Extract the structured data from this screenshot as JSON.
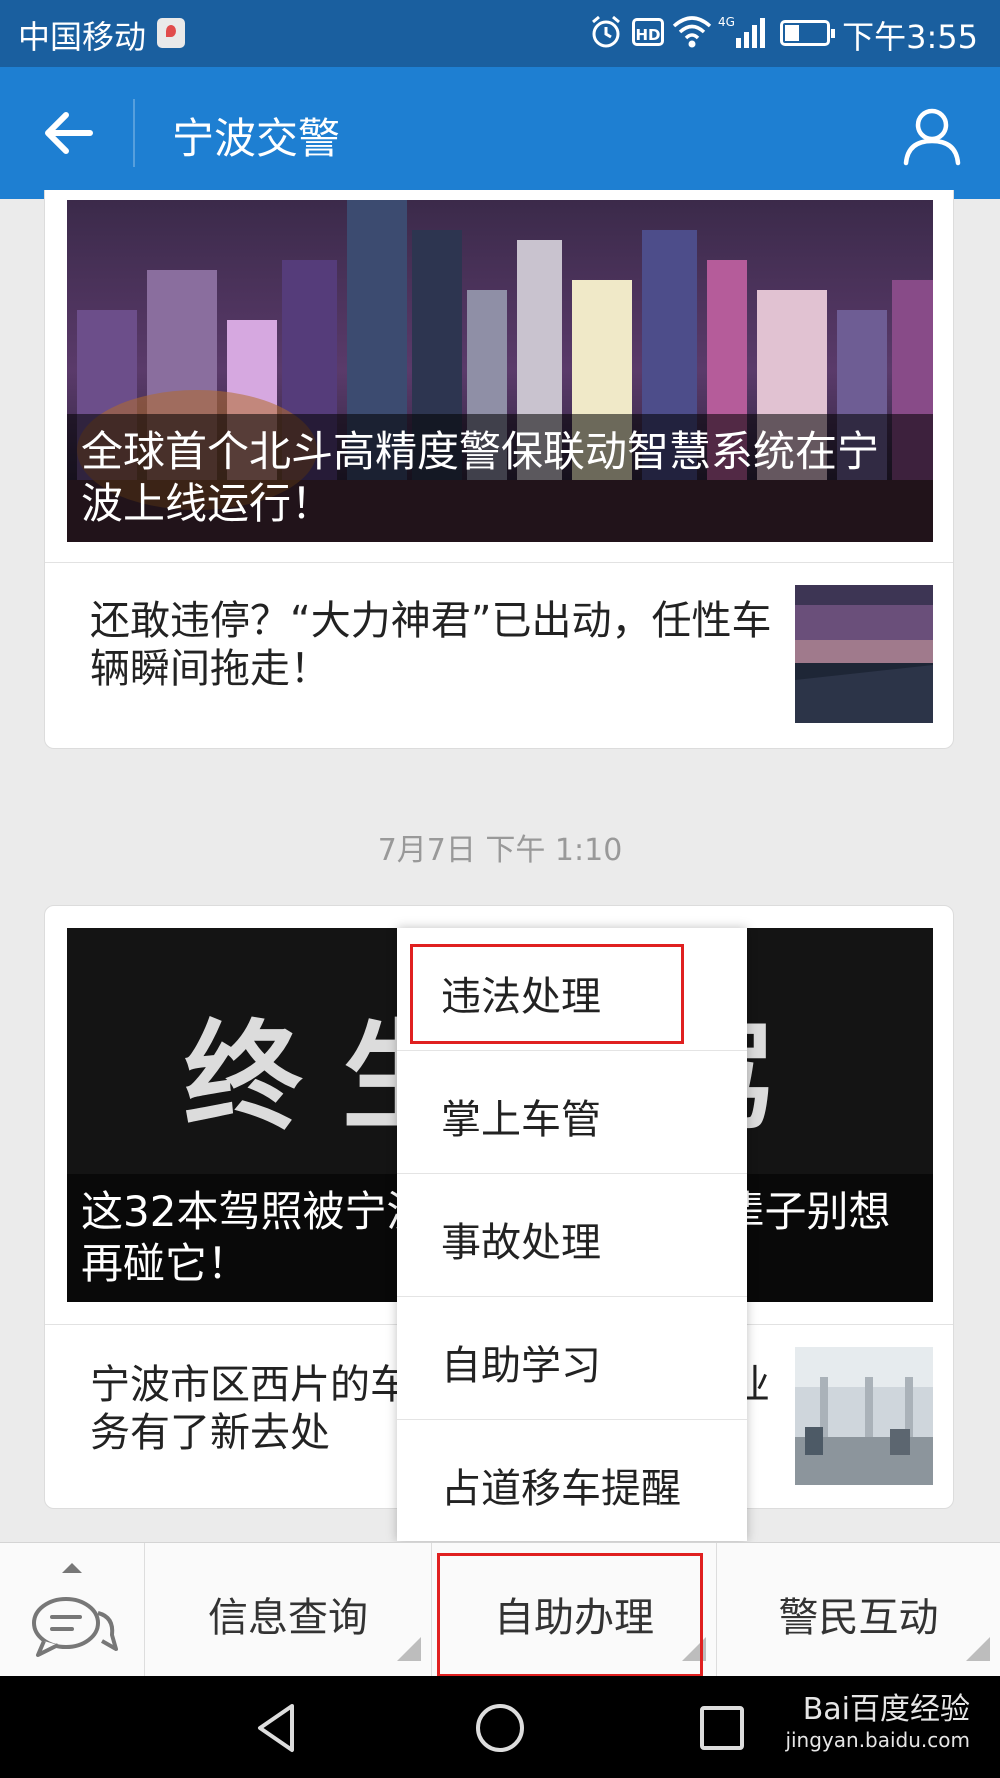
{
  "status_bar": {
    "carrier": "中国移动",
    "network": "4G",
    "hd": "HD",
    "time": "下午3:55"
  },
  "header": {
    "title": "宁波交警"
  },
  "feed": [
    {
      "hero_caption": "全球首个北斗高精度警保联动智慧系统在宁波上线运行！",
      "item_text": "还敢违停？“大力神君”已出动，任性车辆瞬间拖走！"
    },
    {
      "timestamp": "7月7日 下午 1:10",
      "hero_caption": "这32本驾照被宁波交警注销了，这辈子别想再碰它！",
      "hero_overlay_text": "终生禁驾",
      "item_text": "宁波市区西片的车主注意了，车驾管业务有了新去处"
    }
  ],
  "popup_menu": {
    "items": [
      {
        "label": "违法处理",
        "highlighted": true
      },
      {
        "label": "掌上车管",
        "highlighted": false
      },
      {
        "label": "事故处理",
        "highlighted": false
      },
      {
        "label": "自助学习",
        "highlighted": false
      },
      {
        "label": "占道移车提醒",
        "highlighted": false
      }
    ]
  },
  "bottom_menu": {
    "tabs": [
      {
        "label": "信息查询",
        "highlighted": false
      },
      {
        "label": "自助办理",
        "highlighted": true
      },
      {
        "label": "警民互动",
        "highlighted": false
      }
    ]
  },
  "watermark": {
    "main": "Bai百度经验",
    "sub": "jingyan.baidu.com"
  },
  "colors": {
    "status_bar": "#1a5f9f",
    "app_bar": "#1e7fd2",
    "highlight": "#e02020",
    "background": "#ebebeb"
  }
}
